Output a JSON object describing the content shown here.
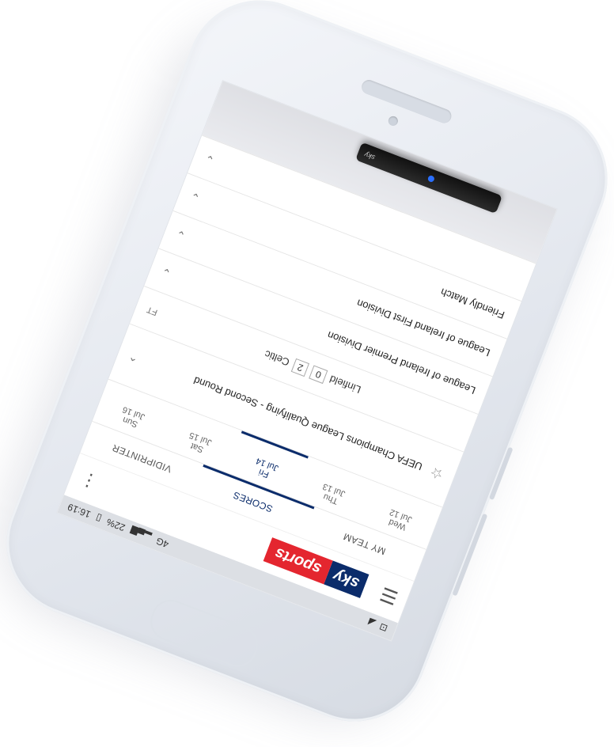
{
  "status": {
    "time": "16:19",
    "battery": "22%",
    "network": "4G"
  },
  "app": {
    "logo_sky": "sky",
    "logo_sports": "sports",
    "menu_icon": "hamburger-icon",
    "more_icon": "kebab-icon"
  },
  "tabs": [
    {
      "label": "MY TEAM"
    },
    {
      "label": "SCORES",
      "active": true
    },
    {
      "label": "VIDIPRINTER"
    }
  ],
  "days": [
    {
      "dow": "Wed",
      "date": "Jul 12"
    },
    {
      "dow": "Thu",
      "date": "Jul 13"
    },
    {
      "dow": "Fri",
      "date": "Jul 14",
      "active": true
    },
    {
      "dow": "Sat",
      "date": "Jul 15"
    },
    {
      "dow": "Sun",
      "date": "Jul 16"
    }
  ],
  "competitions": [
    {
      "title": "UEFA Champions League Qualifying - Second Round"
    },
    {
      "title": "League of Ireland Premier Division"
    },
    {
      "title": "League of Ireland First Division"
    },
    {
      "title": "Friendly Match"
    }
  ],
  "match": {
    "home": "Linfield",
    "home_score": "0",
    "away_score": "2",
    "away": "Celtic",
    "status": "FT"
  },
  "colors": {
    "brand_blue": "#0b2c6b",
    "brand_red": "#e4262f"
  }
}
